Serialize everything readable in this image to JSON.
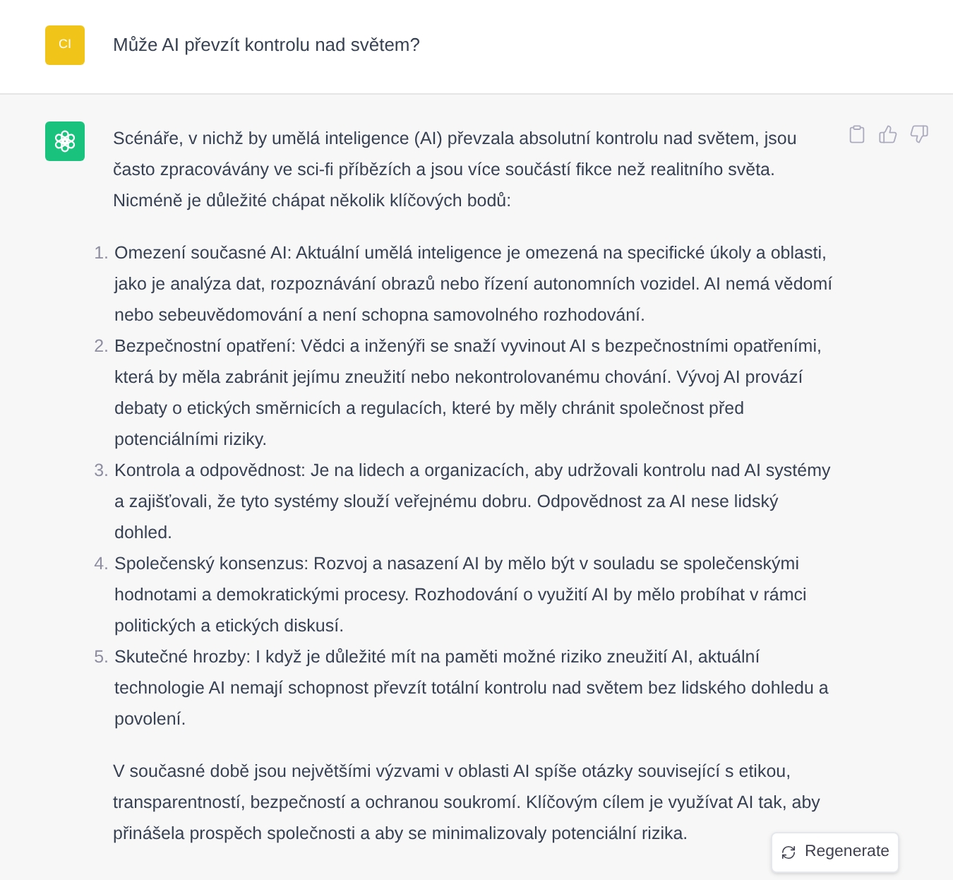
{
  "user_message": {
    "avatar": "CI",
    "text": "Může AI převzít kontrolu nad světem?"
  },
  "assistant_message": {
    "intro": "Scénáře, v nichž by umělá inteligence (AI) převzala absolutní kontrolu nad světem, jsou často zpracovávány ve sci-fi příbězích a jsou více součástí fikce než realitního světa. Nicméně je důležité chápat několik klíčových bodů:",
    "list": [
      {
        "number": "1.",
        "text": "Omezení současné AI: Aktuální umělá inteligence je omezená na specifické úkoly a oblasti, jako je analýza dat, rozpoznávání obrazů nebo řízení autonomních vozidel. AI nemá vědomí nebo sebeuvědomování a není schopna samovolného rozhodování."
      },
      {
        "number": "2.",
        "text": "Bezpečnostní opatření: Vědci a inženýři se snaží vyvinout AI s bezpečnostními opatřeními, která by měla zabránit jejímu zneužití nebo nekontrolovanému chování. Vývoj AI provází debaty o etických směrnicích a regulacích, které by měly chránit společnost před potenciálními riziky."
      },
      {
        "number": "3.",
        "text": "Kontrola a odpovědnost: Je na lidech a organizacích, aby udržovali kontrolu nad AI systémy a zajišťovali, že tyto systémy slouží veřejnému dobru. Odpovědnost za AI nese lidský dohled."
      },
      {
        "number": "4.",
        "text": "Společenský konsenzus: Rozvoj a nasazení AI by mělo být v souladu se společenskými hodnotami a demokratickými procesy. Rozhodování o využití AI by mělo probíhat v rámci politických a etických diskusí."
      },
      {
        "number": "5.",
        "text": "Skutečné hrozby: I když je důležité mít na paměti možné riziko zneužití AI, aktuální technologie AI nemají schopnost převzít totální kontrolu nad světem bez lidského dohledu a povolení."
      }
    ],
    "conclusion": "V současné době jsou největšími výzvami v oblasti AI spíše otázky související s etikou, transparentností, bezpečností a ochranou soukromí. Klíčovým cílem je využívat AI tak, aby přinášela prospěch společnosti a aby se minimalizovaly potenciální rizika."
  },
  "regenerate_button": {
    "label": "Regenerate"
  }
}
